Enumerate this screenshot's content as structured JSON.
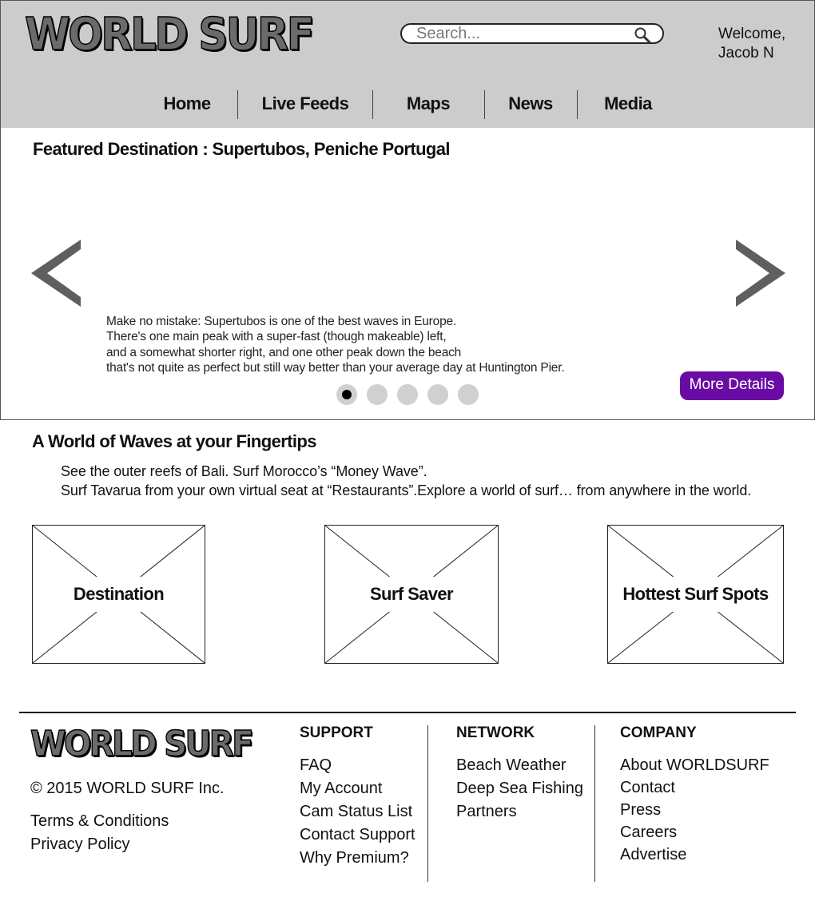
{
  "brand": {
    "logo_text": "WORLD SURF"
  },
  "search": {
    "placeholder": "Search..."
  },
  "user": {
    "welcome_line1": "Welcome,",
    "welcome_line2": "Jacob N"
  },
  "nav": {
    "items": [
      {
        "label": "Home"
      },
      {
        "label": "Live Feeds"
      },
      {
        "label": "Maps"
      },
      {
        "label": "News"
      },
      {
        "label": "Media"
      }
    ]
  },
  "featured": {
    "title": "Featured Destination : Supertubos, Peniche Portugal",
    "description_lines": [
      "Make no mistake: Supertubos is one of the best waves in Europe.",
      "There's one main peak with a super-fast (though makeable) left,",
      "and a somewhat shorter right, and one other peak down the beach",
      "that's not quite as perfect but still way better than your average day at Huntington Pier."
    ],
    "more_label": "More Details",
    "slide_count": 5,
    "active_slide": 1,
    "accent_color": "#6a0ba3"
  },
  "section": {
    "title": "A World of Waves at your Fingertips",
    "line1": "See the outer reefs of Bali. Surf Morocco’s “Money Wave”.",
    "line2": "Surf Tavarua from your own virtual seat at “Restaurants”.Explore a world of surf… from anywhere in the world."
  },
  "cards": [
    {
      "label": "Destination"
    },
    {
      "label": "Surf Saver"
    },
    {
      "label": "Hottest Surf Spots"
    }
  ],
  "footer": {
    "copyright": "© 2015 WORLD SURF Inc.",
    "legal": [
      "Terms & Conditions",
      "Privacy Policy"
    ],
    "support": {
      "heading": "SUPPORT",
      "links": [
        "FAQ",
        "My Account",
        "Cam Status List",
        "Contact Support",
        "Why Premium?"
      ]
    },
    "network": {
      "heading": "NETWORK",
      "links": [
        "Beach Weather",
        "Deep Sea Fishing",
        "Partners"
      ]
    },
    "company": {
      "heading": "COMPANY",
      "links": [
        "About WORLDSURF",
        "Contact",
        "Press",
        "Careers",
        "Advertise"
      ]
    }
  },
  "icons": {
    "search": "search-icon",
    "prev": "chevron-left-icon",
    "next": "chevron-right-icon",
    "placeholder_image": "image-placeholder-icon"
  }
}
